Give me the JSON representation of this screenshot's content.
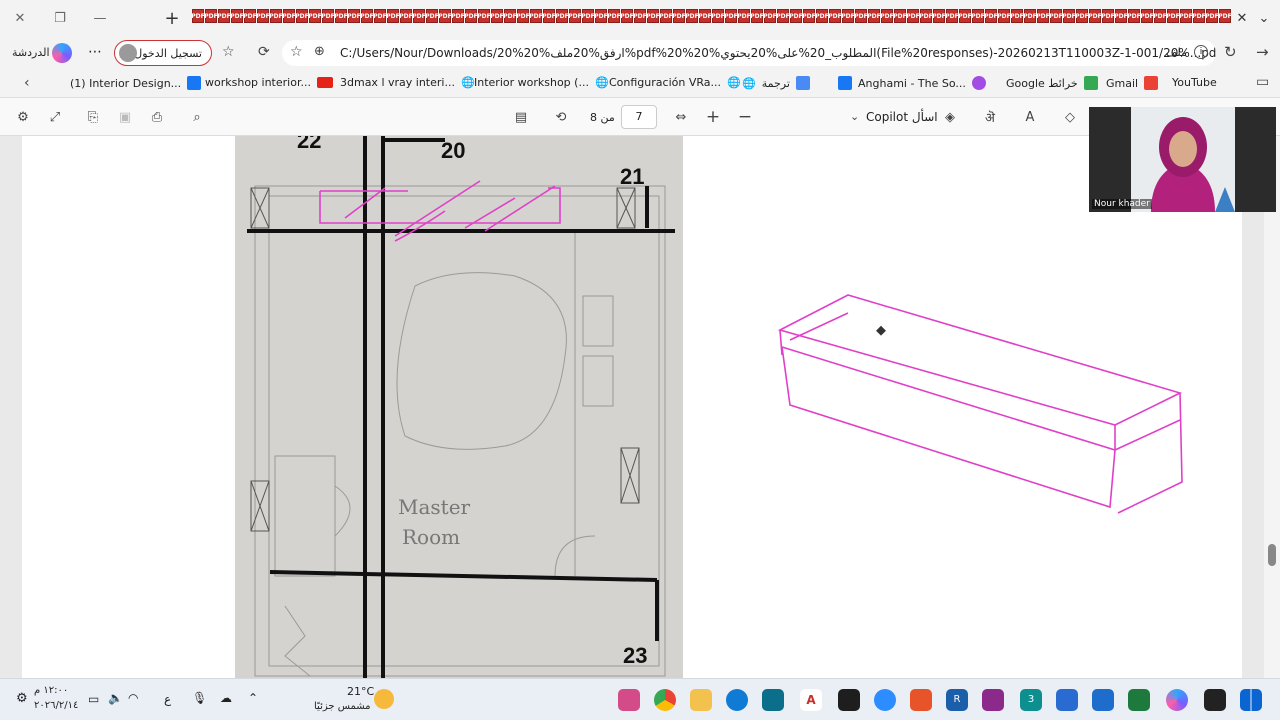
{
  "tabs": {
    "count": 80,
    "tab_glyph": "PDF"
  },
  "address_bar": {
    "chat_label": "الدردشة",
    "signin_label": "تسجيل الدخول",
    "url": "C:/Users/Nour/Downloads/20%ارفق%20ملف%20%pdf%20%20%المطلوب_20%على%20يحتوي(File%20responses)-20260213T110003Z-1-001/20%...pdfارفق",
    "file_label": "ملف"
  },
  "favorites": [
    {
      "label": "(1) Interior Design...",
      "icon": "facebook-icon"
    },
    {
      "label": "workshop interior...",
      "icon": "youtube-icon"
    },
    {
      "label": "3dmax l vray interi...",
      "icon": "globe-icon"
    },
    {
      "label": "Interior workshop (...",
      "icon": "globe-icon"
    },
    {
      "label": "Configuración VRa...",
      "icon": "globe-icon"
    },
    {
      "label": "ترجمة",
      "icon": "translate-icon"
    },
    {
      "label": "Anghami - The So...",
      "icon": "facebook-icon"
    },
    {
      "label": "Google خرائط",
      "icon": "anghami-icon"
    },
    {
      "label": "Gmail",
      "icon": "maps-icon"
    },
    {
      "label": "YouTube",
      "icon": "gmail-icon"
    }
  ],
  "pdf_toolbar": {
    "page_current": "7",
    "page_of": "من 8",
    "copilot_label": "Copilot اسأل"
  },
  "sketch": {
    "labels": [
      "22",
      "20",
      "21",
      "23"
    ],
    "room_line1": "Master",
    "room_line2": "Room"
  },
  "webcam": {
    "name": "Nour khader"
  },
  "taskbar": {
    "weather_temp": "21°C",
    "weather_desc": "مشمس جزئيًا",
    "time": "١٢:٠٠ م",
    "date": "٢٠٢٦/٢/١٤",
    "lang": "ع"
  },
  "colors": {
    "accent": "#e040c8",
    "brand": "#0a64d2"
  }
}
